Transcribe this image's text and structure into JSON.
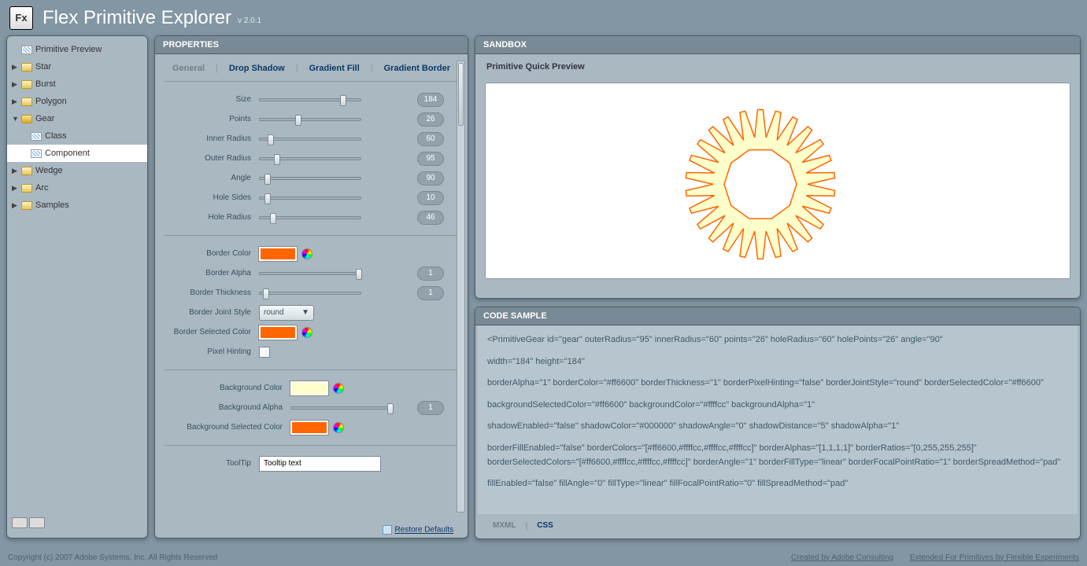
{
  "header": {
    "title": "Flex Primitive Explorer",
    "version": "v 2.0.1",
    "logo": "Fx"
  },
  "sidebar": {
    "root": "Primitive Preview",
    "items": [
      {
        "label": "Star",
        "open": false
      },
      {
        "label": "Burst",
        "open": false
      },
      {
        "label": "Polygon",
        "open": false
      },
      {
        "label": "Gear",
        "open": true,
        "children": [
          {
            "label": "Class",
            "kind": "class"
          },
          {
            "label": "Component",
            "kind": "comp",
            "selected": true
          }
        ]
      },
      {
        "label": "Wedge",
        "open": false
      },
      {
        "label": "Arc",
        "open": false
      },
      {
        "label": "Samples",
        "open": false
      }
    ]
  },
  "properties": {
    "title": "PROPERTIES",
    "tabs": [
      "General",
      "Drop Shadow",
      "Gradient Fill",
      "Gradient Border"
    ],
    "active_tab": 0,
    "sliders": [
      {
        "label": "Size",
        "value": 184,
        "pct": 80
      },
      {
        "label": "Points",
        "value": 26,
        "pct": 35
      },
      {
        "label": "Inner Radius",
        "value": 60,
        "pct": 8
      },
      {
        "label": "Outer Radius",
        "value": 95,
        "pct": 14
      },
      {
        "label": "Angle",
        "value": 90,
        "pct": 5
      },
      {
        "label": "Hole Sides",
        "value": 10,
        "pct": 5
      },
      {
        "label": "Hole Radius",
        "value": 46,
        "pct": 10
      }
    ],
    "border": {
      "color_label": "Border Color",
      "color": "#ff6600",
      "alpha_label": "Border Alpha",
      "alpha": 1,
      "alpha_pct": 95,
      "thickness_label": "Border Thickness",
      "thickness": 1,
      "thick_pct": 3,
      "joint_label": "Border Joint Style",
      "joint": "round",
      "sel_label": "Border Selected Color",
      "sel_color": "#ff6600",
      "hint_label": "Pixel Hinting"
    },
    "background": {
      "color_label": "Background Color",
      "color": "#ffffcc",
      "alpha_label": "Background Alpha",
      "alpha": 1,
      "alpha_pct": 95,
      "sel_label": "Background Selected Color",
      "sel_color": "#ff6600"
    },
    "tooltip": {
      "label": "ToolTip",
      "value": "Tooltip text"
    },
    "restore": "Restore Defaults"
  },
  "sandbox": {
    "title": "SANDBOX",
    "preview": "Primitive Quick Preview"
  },
  "code": {
    "title": "CODE SAMPLE",
    "tabs": [
      "MXML",
      "CSS"
    ],
    "active": 0,
    "lines": [
      "<PrimitiveGear id=\"gear\" outerRadius=\"95\" innerRadius=\"60\" points=\"26\" holeRadius=\"60\" holePoints=\"26\" angle=\"90\"",
      "width=\"184\" height=\"184\"",
      "borderAlpha=\"1\" borderColor=\"#ff6600\" borderThickness=\"1\" borderPixelHinting=\"false\" borderJointStyle=\"round\" borderSelectedColor=\"#ff6600\"",
      "backgroundSelectedColor=\"#ff6600\" backgroundColor=\"#ffffcc\" backgroundAlpha=\"1\"",
      "shadowEnabled=\"false\" shadowColor=\"#000000\" shadowAngle=\"0\" shadowDistance=\"5\" shadowAlpha=\"1\"",
      "borderFillEnabled=\"false\" borderColors=\"[#ff6600,#ffffcc,#ffffcc,#ffffcc]\" borderAlphas=\"[1,1,1,1]\" borderRatios=\"[0,255,255,255]\" borderSelectedColors=\"[#ff6600,#ffffcc,#ffffcc,#ffffcc]\" borderAngle=\"1\" borderFillType=\"linear\" borderFocalPointRatio=\"1\" borderSpreadMethod=\"pad\"",
      "fillEnabled=\"false\" fillAngle=\"0\" fillType=\"linear\" fillFocalPointRatio=\"0\" fillSpreadMethod=\"pad\""
    ]
  },
  "footer": {
    "copyright": "Copyright (c) 2007 Adobe Systems, Inc. All Rights Reserved",
    "link1": "Created by Adobe Consulting",
    "link2": "Extended For Primitives by Flexible Experiments"
  },
  "chart_data": {
    "type": "diagram",
    "description": "gear primitive preview",
    "outerRadius": 95,
    "innerRadius": 60,
    "points": 26,
    "holeSides": 10,
    "holeRadius": 46,
    "borderColor": "#ff6600",
    "fillColor": "#ffffcc"
  }
}
